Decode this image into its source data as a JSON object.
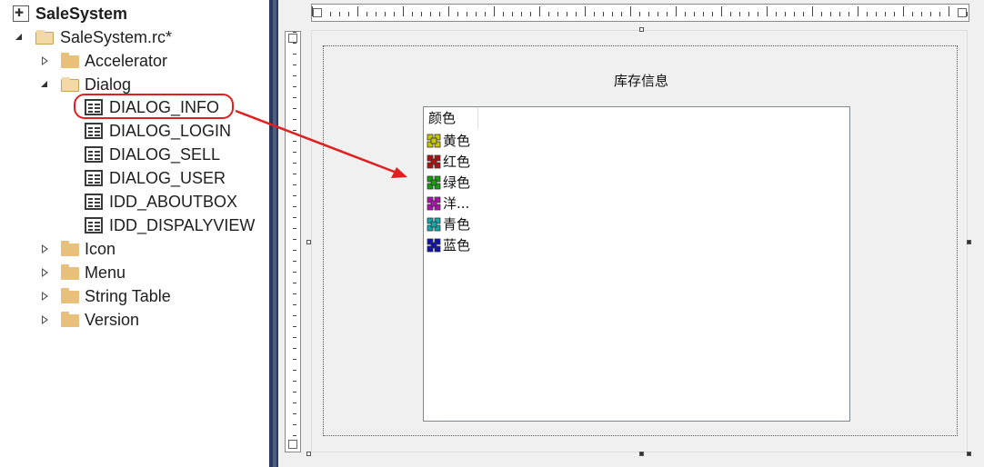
{
  "tree": {
    "root": {
      "label": "SaleSystem",
      "icon": "project-icon"
    },
    "rc_file": {
      "label": "SaleSystem.rc*",
      "icon": "folder-open-icon"
    },
    "items": [
      {
        "label": "Accelerator",
        "type": "folder",
        "state": "collapsed"
      },
      {
        "label": "Dialog",
        "type": "folder",
        "state": "expanded"
      },
      {
        "label": "DIALOG_INFO",
        "type": "dialog",
        "selected": true
      },
      {
        "label": "DIALOG_LOGIN",
        "type": "dialog"
      },
      {
        "label": "DIALOG_SELL",
        "type": "dialog"
      },
      {
        "label": "DIALOG_USER",
        "type": "dialog"
      },
      {
        "label": "IDD_ABOUTBOX",
        "type": "dialog"
      },
      {
        "label": "IDD_DISPALYVIEW",
        "type": "dialog"
      },
      {
        "label": "Icon",
        "type": "folder",
        "state": "collapsed"
      },
      {
        "label": "Menu",
        "type": "folder",
        "state": "collapsed"
      },
      {
        "label": "String Table",
        "type": "folder",
        "state": "collapsed"
      },
      {
        "label": "Version",
        "type": "folder",
        "state": "collapsed"
      }
    ]
  },
  "annotation": {
    "color": "#e02020"
  },
  "dialog": {
    "title": "库存信息",
    "list": {
      "header": "颜色",
      "items": [
        {
          "label": "黄色",
          "color": "#c8c800"
        },
        {
          "label": "红色",
          "color": "#b01010"
        },
        {
          "label": "绿色",
          "color": "#10a010"
        },
        {
          "label": "洋...",
          "color": "#b010b0"
        },
        {
          "label": "青色",
          "color": "#10a8a8"
        },
        {
          "label": "蓝色",
          "color": "#1010b0"
        }
      ]
    }
  }
}
